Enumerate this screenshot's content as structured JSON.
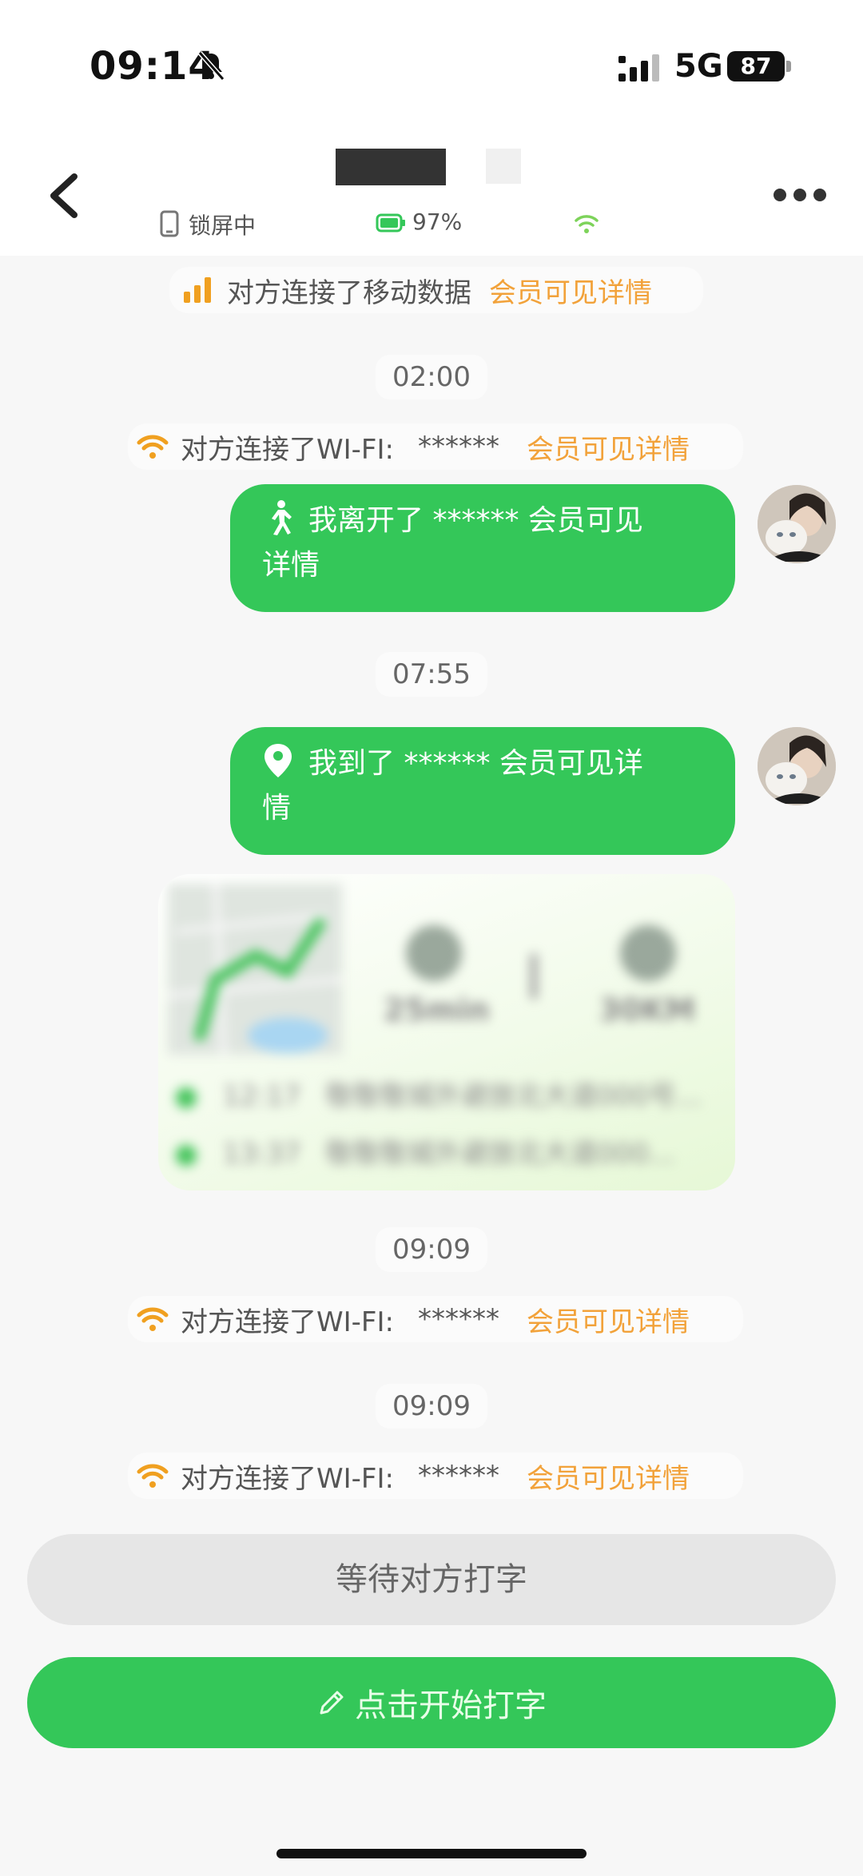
{
  "status_bar": {
    "time": "09:14",
    "network": "5G",
    "battery": "87"
  },
  "header": {
    "lock_status": "锁屏中",
    "battery_level": "97%"
  },
  "messages": {
    "mobile_data": {
      "text": "对方连接了移动数据",
      "link": "会员可见详情"
    },
    "ts1": "02:00",
    "wifi1": {
      "text": "对方连接了WI-FI:",
      "mask": "******",
      "link": "会员可见详情"
    },
    "left": {
      "line1": "我离开了 ****** 会员可见",
      "line2": "详情"
    },
    "ts2": "07:55",
    "arrived": {
      "line1": "我到了 ****** 会员可见详",
      "line2": "情"
    },
    "ts3": "09:09",
    "wifi2": {
      "text": "对方连接了WI-FI:",
      "mask": "******",
      "link": "会员可见详情"
    },
    "ts4": "09:09",
    "wifi3": {
      "text": "对方连接了WI-FI:",
      "mask": "******",
      "link": "会员可见详情"
    }
  },
  "trip_card": {
    "duration": "25min",
    "distance": "30KM",
    "stops": [
      {
        "time": "12:17",
        "address": "敬敬敬城外避放北大道000号..."
      },
      {
        "time": "13:37",
        "address": "敬敬敬城外避放北大道000..."
      }
    ]
  },
  "actions": {
    "wait_label": "等待对方打字",
    "type_label": "点击开始打字"
  },
  "colors": {
    "accent_green": "#34c759",
    "link_orange": "#f2a23a",
    "wifi_orange": "#f0a020"
  }
}
